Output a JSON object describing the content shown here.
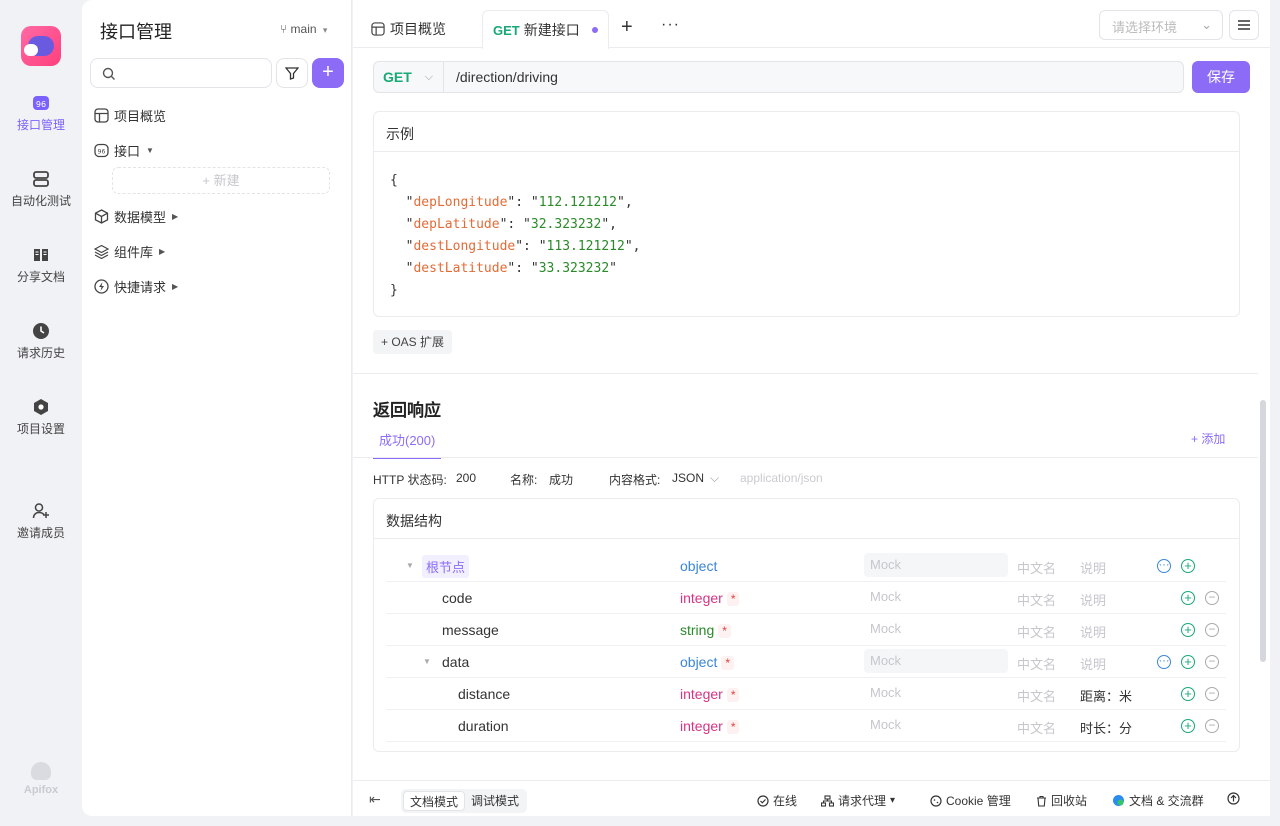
{
  "rail": {
    "items": [
      {
        "label": "接口管理",
        "icon": "api-icon",
        "active": true
      },
      {
        "label": "自动化测试",
        "icon": "automation-icon"
      },
      {
        "label": "分享文档",
        "icon": "book-icon"
      },
      {
        "label": "请求历史",
        "icon": "clock-icon"
      },
      {
        "label": "项目设置",
        "icon": "hexagon-icon"
      },
      {
        "label": "邀请成员",
        "icon": "user-plus-icon"
      }
    ],
    "brand": "Apifox"
  },
  "sidebar": {
    "title": "接口管理",
    "branch": "main",
    "search_placeholder": "",
    "tree": [
      {
        "label": "项目概览",
        "icon": "overview-icon"
      },
      {
        "label": "接口",
        "icon": "api-icon"
      },
      {
        "label": "数据模型",
        "icon": "cube-icon"
      },
      {
        "label": "组件库",
        "icon": "layers-icon"
      },
      {
        "label": "快捷请求",
        "icon": "bolt-icon"
      }
    ],
    "new_slot": "+ 新建"
  },
  "tabs": [
    {
      "label": "项目概览"
    },
    {
      "method": "GET",
      "label": "新建接口",
      "active": true
    }
  ],
  "env_placeholder": "请选择环境",
  "request": {
    "method": "GET",
    "path": "/direction/driving",
    "save_label": "保存"
  },
  "example": {
    "title": "示例",
    "lines": [
      {
        "key": "depLongitude",
        "value": "112.121212"
      },
      {
        "key": "depLatitude",
        "value": "32.323232"
      },
      {
        "key": "destLongitude",
        "value": "113.121212"
      },
      {
        "key": "destLatitude",
        "value": "33.323232"
      }
    ]
  },
  "oas_label": "+ OAS 扩展",
  "response": {
    "title": "返回响应",
    "tab": "成功(200)",
    "add_label": "+ 添加",
    "http_status_label": "HTTP 状态码:",
    "http_status": "200",
    "name_label": "名称:",
    "name": "成功",
    "content_type_label": "内容格式:",
    "content_type": "JSON",
    "mime": "application/json"
  },
  "schema": {
    "title": "数据结构",
    "mock_placeholder": "Mock",
    "cn_placeholder": "中文名",
    "desc_placeholder": "说明",
    "rows": [
      {
        "name": "根节点",
        "type": "object",
        "root": true,
        "required": false,
        "desc": ""
      },
      {
        "name": "code",
        "type": "integer",
        "required": true,
        "desc": ""
      },
      {
        "name": "message",
        "type": "string",
        "required": true,
        "desc": ""
      },
      {
        "name": "data",
        "type": "object",
        "required": true,
        "desc": ""
      },
      {
        "name": "distance",
        "type": "integer",
        "required": true,
        "desc": "距离：米"
      },
      {
        "name": "duration",
        "type": "integer",
        "required": true,
        "desc": "时长：分"
      }
    ]
  },
  "footer": {
    "modes": [
      "文档模式",
      "调试模式"
    ],
    "online": "在线",
    "proxy": "请求代理",
    "cookie": "Cookie 管理",
    "recycle": "回收站",
    "docs": "文档 & 交流群"
  },
  "colors": {
    "accent": "#8c6cf7",
    "get": "#19a974",
    "object": "#3a86d8",
    "integer": "#d63384",
    "string": "#2a8a2a"
  }
}
